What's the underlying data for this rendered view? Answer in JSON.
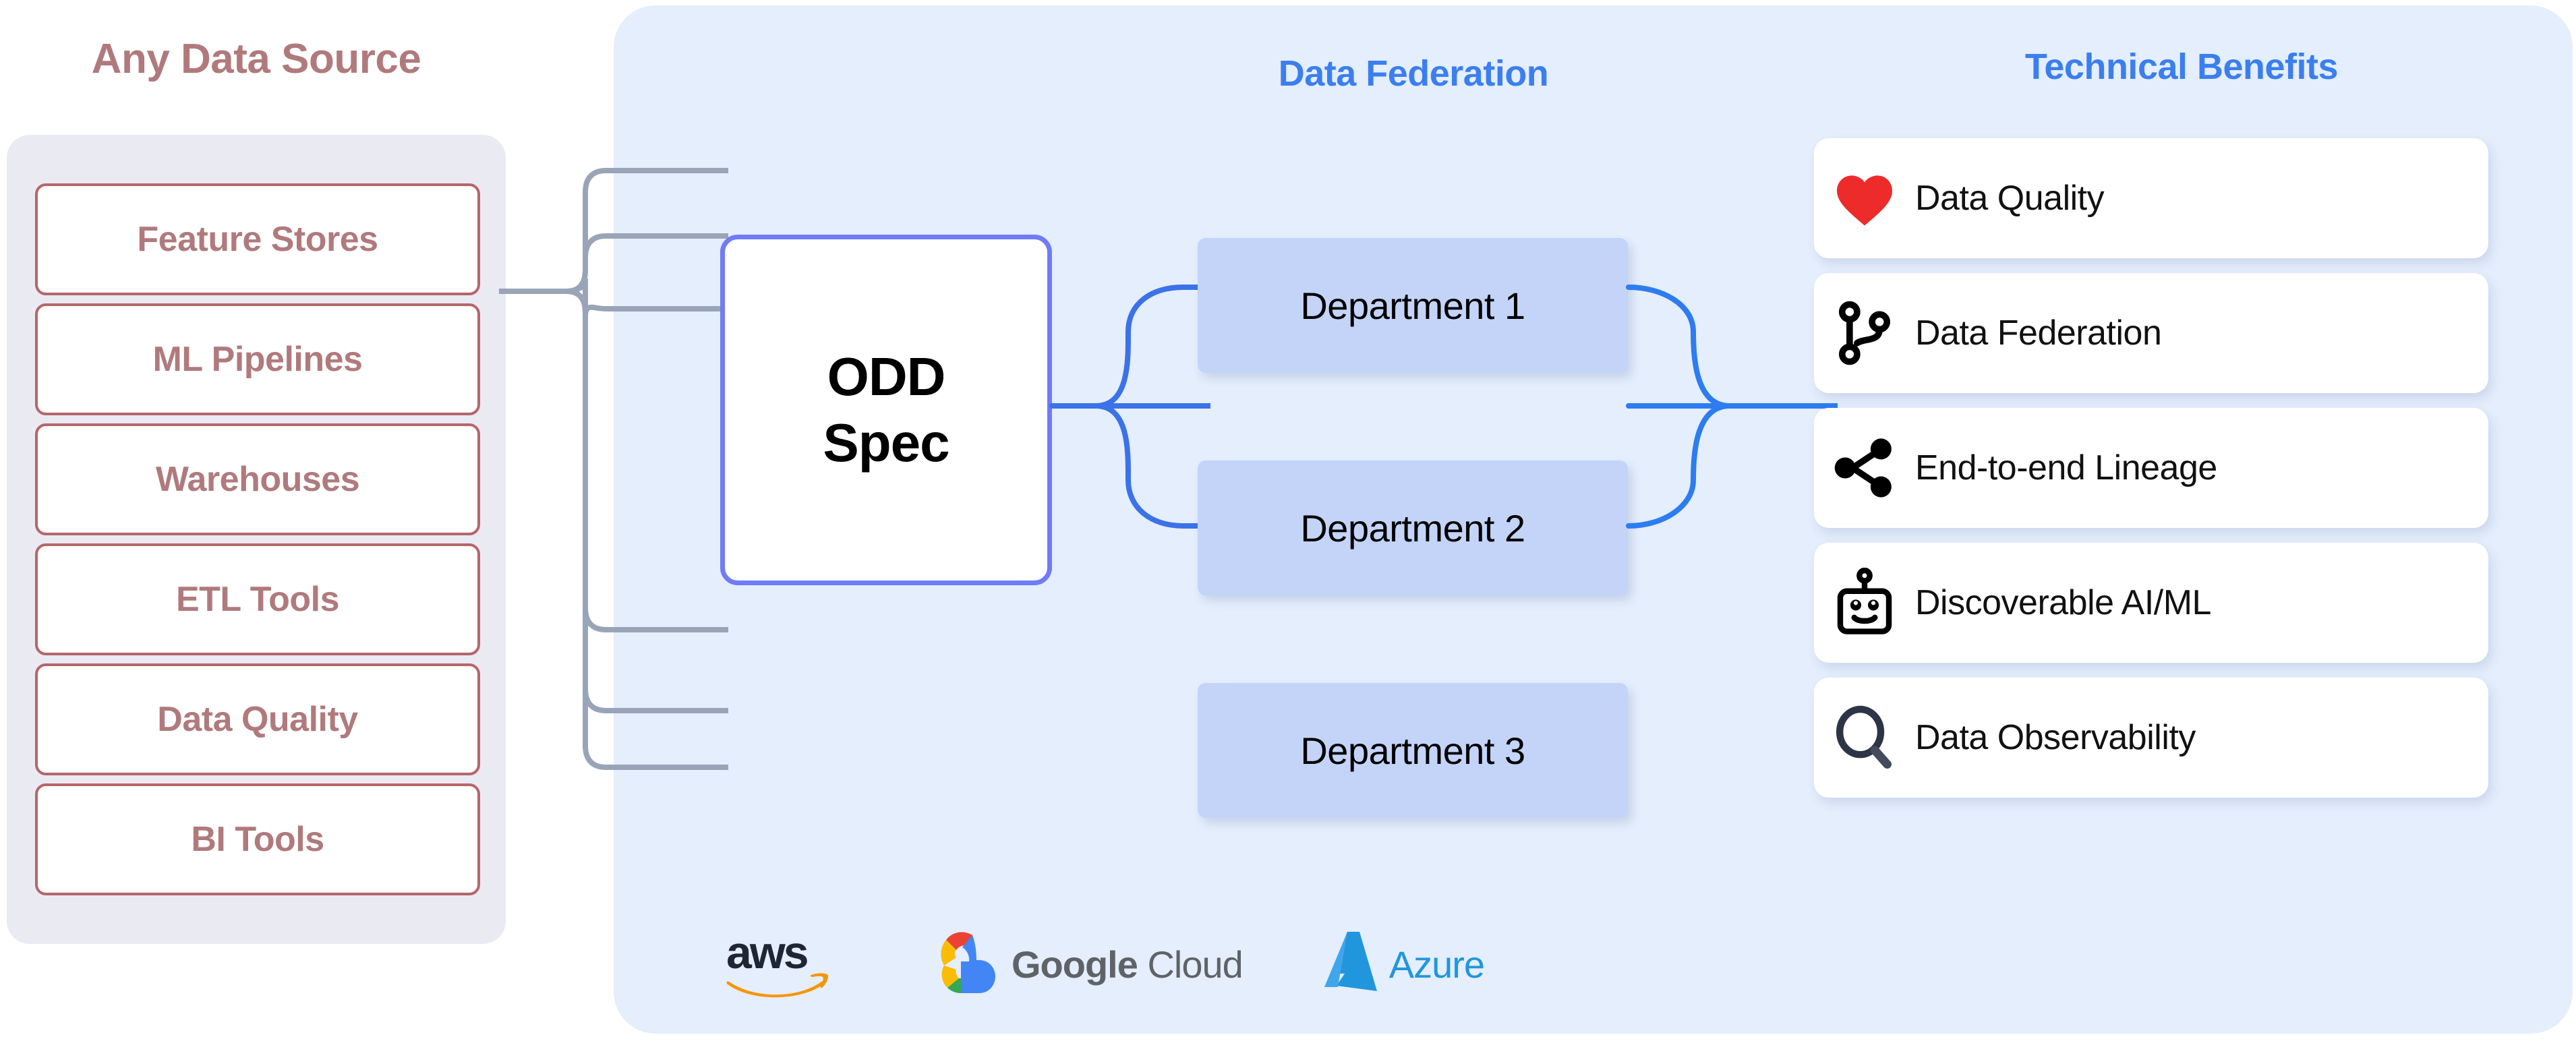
{
  "left_column": {
    "title": "Any Data Source",
    "title_color": "#b07a7c",
    "sources": [
      "Feature Stores",
      "ML Pipelines",
      "Warehouses",
      "ETL Tools",
      "Data Quality",
      "BI Tools"
    ]
  },
  "center": {
    "spec_line1": "ODD",
    "spec_line2": "Spec",
    "spec_border_color": "#6f7bf7"
  },
  "federation": {
    "title": "Data Federation",
    "title_color": "#3b7ef0",
    "departments": [
      "Department 1",
      "Department 2",
      "Department 3"
    ]
  },
  "benefits": {
    "title": "Technical Benefits",
    "title_color": "#3b7ef0",
    "items": [
      {
        "icon": "heart-icon",
        "label": "Data Quality"
      },
      {
        "icon": "git-branch-icon",
        "label": "Data Federation"
      },
      {
        "icon": "share-nodes-icon",
        "label": "End-to-end Lineage"
      },
      {
        "icon": "robot-icon",
        "label": "Discoverable AI/ML"
      },
      {
        "icon": "magnifier-icon",
        "label": "Data Observability"
      }
    ]
  },
  "clouds": [
    {
      "icon": "aws-logo",
      "label": "aws"
    },
    {
      "icon": "google-cloud-logo",
      "label_strong": "Google",
      "label_light": "Cloud"
    },
    {
      "icon": "azure-logo",
      "label": "Azure"
    }
  ],
  "colors": {
    "panel_bg": "#e4eefc",
    "source_panel_bg": "#eaeaf3",
    "source_border": "#b6666a",
    "dept_bg": "#c3d4f8",
    "connector_gray": "#9aa4b8",
    "connector_blue": "#2d7cf0",
    "heart_red": "#ee2b2b"
  }
}
